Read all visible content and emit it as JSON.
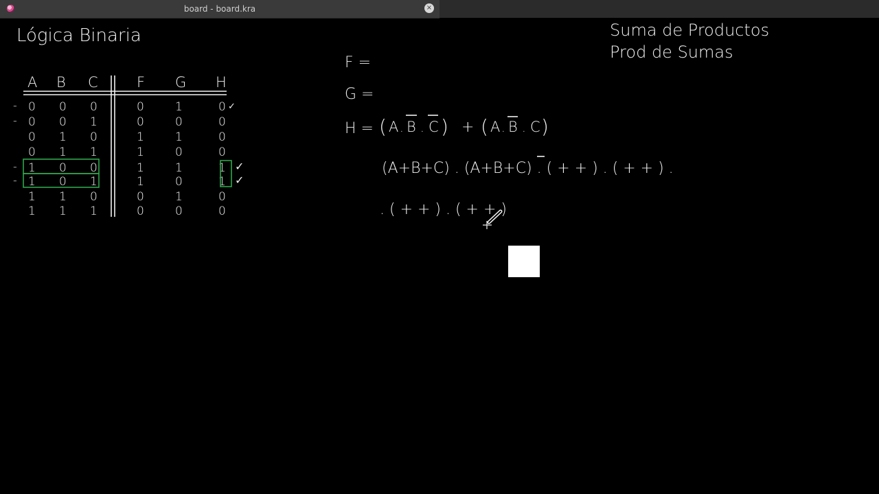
{
  "window": {
    "title": "board - board.kra",
    "close_glyph": "×",
    "app_icon": "krita-icon"
  },
  "board": {
    "title": "Lógica Binaria",
    "notes": [
      "Suma de Productos",
      "Prod de Sumas"
    ],
    "table": {
      "headers": [
        "A",
        "B",
        "C",
        "F",
        "G",
        "H"
      ],
      "rows": [
        [
          "0",
          "0",
          "0",
          "0",
          "1",
          "0"
        ],
        [
          "0",
          "0",
          "1",
          "0",
          "0",
          "0"
        ],
        [
          "0",
          "1",
          "0",
          "1",
          "1",
          "0"
        ],
        [
          "0",
          "1",
          "1",
          "1",
          "0",
          "0"
        ],
        [
          "1",
          "0",
          "0",
          "1",
          "1",
          "1"
        ],
        [
          "1",
          "0",
          "1",
          "1",
          "0",
          "1"
        ],
        [
          "1",
          "1",
          "0",
          "0",
          "1",
          "0"
        ],
        [
          "1",
          "1",
          "1",
          "0",
          "0",
          "0"
        ]
      ],
      "row_marks": [
        "-",
        "-",
        "",
        "",
        "-",
        "-",
        "",
        ""
      ],
      "checks": [
        "✓",
        "",
        "",
        "",
        "✓",
        "✓",
        "",
        ""
      ]
    },
    "equations": {
      "f_label": "F =",
      "g_label": "G =",
      "h_label": "H =",
      "h_term1": [
        "(",
        "A",
        ".",
        "B",
        ".",
        "C",
        ")"
      ],
      "plus": "+",
      "h_term2": [
        "(",
        "A",
        ".",
        "B",
        ".",
        "C",
        ")"
      ],
      "pos_line1": "(A+B+C) . (A+B+C) . ( +  + ) . ( +  + ) .",
      "pos_line2": ". ( +  + ) .  ( +  + )"
    },
    "accent_color": "#2ea84a"
  }
}
